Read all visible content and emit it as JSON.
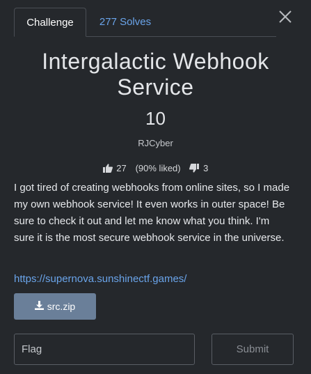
{
  "tabs": [
    {
      "label": "Challenge",
      "active": true
    },
    {
      "label": "277 Solves",
      "active": false
    }
  ],
  "close_icon": "close-icon",
  "challenge": {
    "title_line1": "Intergalactic Webhook",
    "title_line2": "Service",
    "value": "10",
    "author": "RJCyber"
  },
  "rating": {
    "likes": "27",
    "liked_pct": "(90% liked)",
    "dislikes": "3"
  },
  "description": "I got tired of creating webhooks from online sites, so I made my own webhook service! It even works in outer space! Be sure to check it out and let me know what you think. I'm sure it is the most secure webhook service in the universe.",
  "link": "https://supernova.sunshinectf.games/",
  "download": {
    "label": "src.zip",
    "icon": "download-icon"
  },
  "flag_input": {
    "placeholder": "Flag",
    "value": ""
  },
  "submit_label": "Submit",
  "colors": {
    "background": "#25282c",
    "accent_link": "#6aa4ea",
    "download_button": "#6a7f99"
  }
}
